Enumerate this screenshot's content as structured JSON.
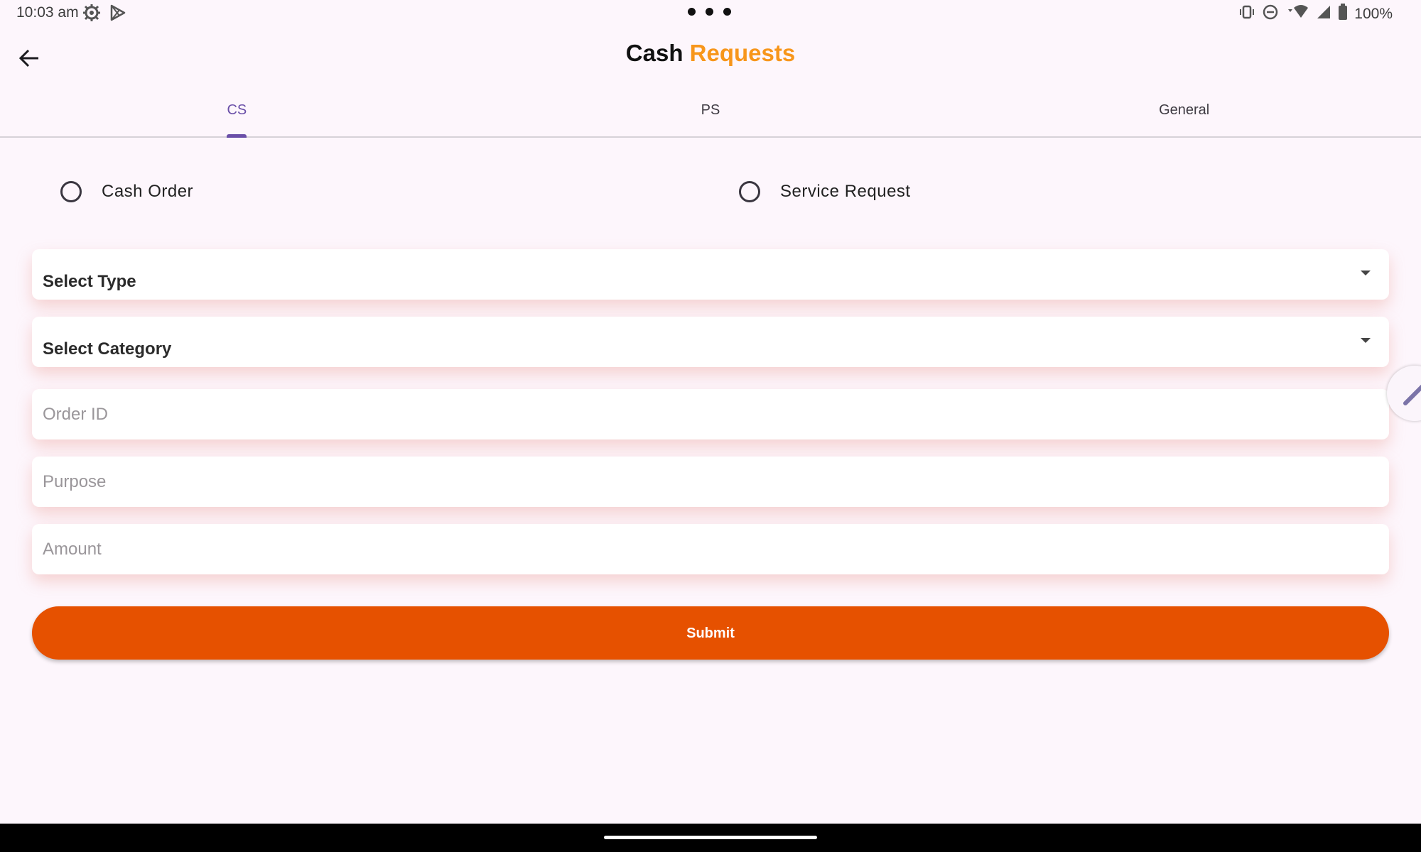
{
  "status_bar": {
    "time": "10:03 am",
    "battery": "100%",
    "icons": [
      "settings-gear-icon",
      "play-store-icon",
      "vibrate-icon",
      "do-not-disturb-icon",
      "wifi-icon",
      "signal-icon",
      "battery-icon"
    ]
  },
  "app_bar": {
    "back_icon": "arrow-back-icon",
    "title_main": "Cash",
    "title_accent": "Requests",
    "accent_color": "#f7961b"
  },
  "tabs": [
    {
      "label": "CS",
      "active": true
    },
    {
      "label": "PS",
      "active": false
    },
    {
      "label": "General",
      "active": false
    }
  ],
  "radio_options": [
    {
      "label": "Cash Order",
      "selected": false
    },
    {
      "label": "Service Request",
      "selected": false
    }
  ],
  "form": {
    "select_type": "Select Type",
    "select_category": "Select Category",
    "order_id_placeholder": "Order ID",
    "purpose_placeholder": "Purpose",
    "amount_placeholder": "Amount"
  },
  "submit_label": "Submit",
  "colors": {
    "background": "#fdf6fc",
    "submit": "#e65100",
    "tab_active": "#6a4fa8"
  }
}
